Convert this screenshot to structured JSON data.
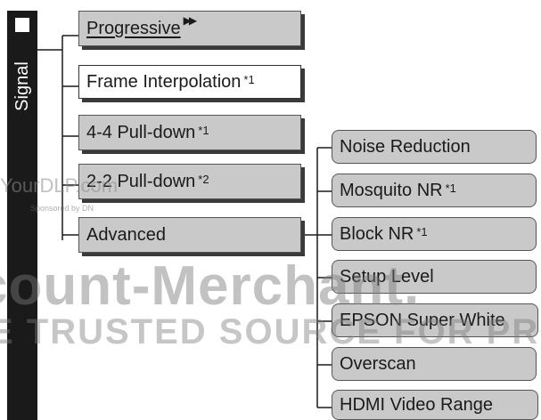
{
  "sidebar": {
    "label": "Signal"
  },
  "menu": {
    "progressive": {
      "label": "Progressive",
      "arrow": "▶▶"
    },
    "frame_interpolation": {
      "label": "Frame Interpolation",
      "note": "*1"
    },
    "pulldown_44": {
      "label": "4-4 Pull-down",
      "note": "*1"
    },
    "pulldown_22": {
      "label": "2-2 Pull-down",
      "note": "*2"
    },
    "advanced": {
      "label": "Advanced"
    }
  },
  "submenu": {
    "noise_reduction": {
      "label": "Noise Reduction"
    },
    "mosquito_nr": {
      "label": "Mosquito NR",
      "note": "*1"
    },
    "block_nr": {
      "label": "Block NR",
      "note": "*1"
    },
    "setup_level": {
      "label": "Setup Level"
    },
    "epson_super_white": {
      "label": "EPSON Super White"
    },
    "overscan": {
      "label": "Overscan"
    },
    "hdmi_video_range": {
      "label": "HDMI Video Range"
    }
  },
  "watermark": {
    "line1": "YourDLP.com",
    "line1_sub": "Sponsored by DN",
    "line2": "count-Merchant.",
    "line3": "E TRUSTED SOURCE FOR PROJE"
  }
}
